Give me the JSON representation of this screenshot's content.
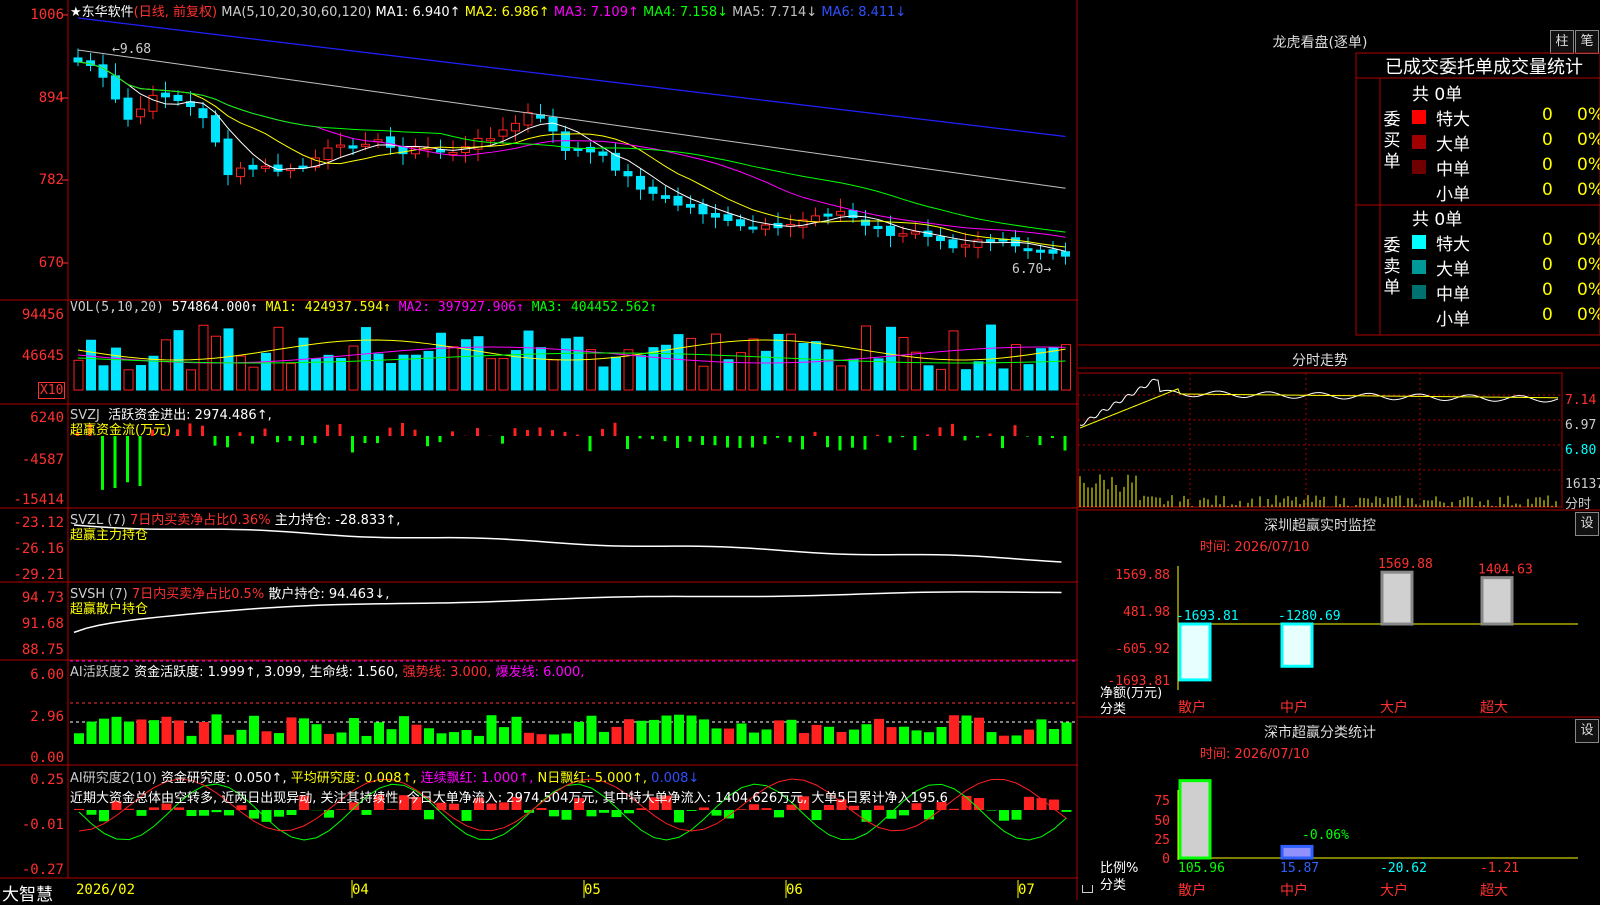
{
  "stock": {
    "star": "★",
    "name": "东华软件",
    "period": "(日线, 前复权)"
  },
  "ma_header": {
    "ma": "MA(5,10,20,30,60,120)",
    "ma1": "MA1: 6.940↑",
    "ma2": "MA2: 6.986↑",
    "ma3": "MA3: 7.109↑",
    "ma4": "MA4: 7.158↓",
    "ma5": "MA5: 7.714↓",
    "ma6": "MA6: 8.411↓"
  },
  "price_axis": [
    "1006",
    "894",
    "782",
    "670"
  ],
  "price_marks": {
    "high": "9.68",
    "low": "6.70"
  },
  "vol_header": {
    "name": "VOL(5,10,20)",
    "v": "574864.000↑",
    "ma1": "MA1: 424937.594↑",
    "ma2": "MA2: 397927.906↑",
    "ma3": "MA3: 404452.562↑"
  },
  "vol_axis": [
    "94456",
    "46645"
  ],
  "vol_unit": "X10",
  "svzj_header": {
    "name": "SVZJ",
    "label": "活跃资金进出: 2974.486↑,",
    "sub": "超赢资金流(万元)"
  },
  "svzj_axis": [
    "6240",
    "-4587",
    "-15414"
  ],
  "svzl_header": {
    "name": "SVZL (7)",
    "red": "7日内买卖净占比0.36%",
    "label": "主力持仓: -28.833↑,",
    "sub": "超赢主力持仓"
  },
  "svzl_axis": [
    "-23.12",
    "-26.16",
    "-29.21"
  ],
  "svsh_header": {
    "name": "SVSH (7)",
    "red": "7日内买卖净占比0.5%",
    "label": "散户持仓: 94.463↓,",
    "sub": "超赢散户持仓"
  },
  "svsh_axis": [
    "94.73",
    "91.68",
    "88.75"
  ],
  "ai_header": {
    "name": "AI活跃度2",
    "a": "资金活跃度: 1.999↑,",
    "b": "3.099,",
    "c": "生命线: 1.560,",
    "d": "强势线: 3.000,",
    "e": "爆发线: 6.000,"
  },
  "ai_axis": [
    "6.00",
    "2.96",
    "0.00"
  ],
  "ai2_header": {
    "name": "AI研究度2(10)",
    "a": "资金研究度: 0.050↑,",
    "b": "平均研究度: 0.008↑,",
    "c": "连续飘红: 1.000↑,",
    "d": "N日飘红: 5.000↑,",
    "e": "0.008↓"
  },
  "ai2_text": "近期大资金总体由空转多, 近两日出现异动, 关注其持续性, 今日大单净流入: 2974.504万元, 其中特大单净流入: 1404.626万元, 大单5日累计净入195.6",
  "ai2_axis": [
    "0.25",
    "-0.01",
    "-0.27"
  ],
  "date_axis": [
    "2026/02",
    "04",
    "05",
    "06",
    "07"
  ],
  "brand": "大智慧",
  "right": {
    "lhb": "龙虎看盘(逐单)",
    "btn_zhu": "柱",
    "btn_bi": "笔",
    "tabs": "已成交委托单成交量统计",
    "buy_label": "委买单",
    "sell_label": "委卖单",
    "buy_total": "共 0单",
    "sell_total": "共 0单",
    "buy_rows": [
      {
        "name": "特大",
        "n": "0",
        "p": "0%",
        "color": "#ff0000"
      },
      {
        "name": "大单",
        "n": "0",
        "p": "0%",
        "color": "#a00000"
      },
      {
        "name": "中单",
        "n": "0",
        "p": "0%",
        "color": "#700000"
      },
      {
        "name": "小单",
        "n": "0",
        "p": "0%",
        "color": "#000000"
      }
    ],
    "sell_rows": [
      {
        "name": "特大",
        "n": "0",
        "p": "0%",
        "color": "#00ffff"
      },
      {
        "name": "大单",
        "n": "0",
        "p": "0%",
        "color": "#009999"
      },
      {
        "name": "中单",
        "n": "0",
        "p": "0%",
        "color": "#007070"
      },
      {
        "name": "小单",
        "n": "0",
        "p": "0%",
        "color": "#000000"
      }
    ],
    "fs_title": "分时走势",
    "fs_axis": [
      "7.14",
      "6.97",
      "6.80"
    ],
    "fs_vol": "16137",
    "fs_unit": "分时",
    "mon_title": "深圳超赢实时监控",
    "mon_time": "时间: 2026/07/10",
    "mon_axis": [
      "1569.88",
      "481.98",
      "-605.92",
      "-1693.81"
    ],
    "mon_bars": [
      {
        "cat": "散户",
        "value": -1693.81,
        "label": "-1693.81",
        "lc": "#00ffff"
      },
      {
        "cat": "中户",
        "value": -1280.69,
        "label": "-1280.69",
        "lc": "#00ffff"
      },
      {
        "cat": "大户",
        "value": 1569.88,
        "label": "1569.88",
        "lc": "#ff3030"
      },
      {
        "cat": "超大",
        "value": 1404.63,
        "label": "1404.63",
        "lc": "#ff3030"
      }
    ],
    "mon_ylabel1": "净额(万元)",
    "mon_ylabel2": "分类",
    "set_btn": "设",
    "cls_title": "深市超赢分类统计",
    "cls_time": "时间: 2026/07/10",
    "cls_axis": [
      "75",
      "50",
      "25",
      "0"
    ],
    "cls_bars": [
      {
        "cat": "散户",
        "value": 105.96,
        "label": "105.96",
        "lc": "#00ff00"
      },
      {
        "cat": "中户",
        "value": 15.87,
        "label": "15.87",
        "lc": "#3060ff"
      },
      {
        "cat": "大户",
        "value": -20.62,
        "label": "-20.62",
        "lc": "#00ffff"
      },
      {
        "cat": "超大",
        "value": -1.21,
        "label": "-1.21",
        "lc": "#ff3030"
      }
    ],
    "cls_mid": "-0.06%",
    "cls_ylabel1": "比例%",
    "cls_ylabel2": "分类"
  },
  "colors": {
    "up": "#ff2020",
    "down": "#00e5ff",
    "grid": "#b00000",
    "ma1": "#ffffff",
    "ma2": "#ffff00",
    "ma3": "#ff00ff",
    "ma4": "#00ff00",
    "ma5": "#c0c0c0",
    "ma6": "#2020ff"
  },
  "chart_data": [
    {
      "type": "line",
      "title": "东华软件 (日线, 前复权)",
      "x": [
        "2026/02",
        "04",
        "05",
        "06",
        "07"
      ],
      "ylim": [
        670,
        1006
      ],
      "series": [
        {
          "name": "MA1",
          "values": [
            6.94
          ]
        },
        {
          "name": "MA2",
          "values": [
            6.986
          ]
        },
        {
          "name": "MA3",
          "values": [
            7.109
          ]
        },
        {
          "name": "MA4",
          "values": [
            7.158
          ]
        },
        {
          "name": "MA5",
          "values": [
            7.714
          ]
        },
        {
          "name": "MA6",
          "values": [
            8.411
          ]
        }
      ]
    },
    {
      "type": "bar",
      "title": "VOL(5,10,20)",
      "ylim": [
        0,
        94456
      ],
      "series": [
        {
          "name": "MA1",
          "values": [
            424937.594
          ]
        },
        {
          "name": "MA2",
          "values": [
            397927.906
          ]
        },
        {
          "name": "MA3",
          "values": [
            404452.562
          ]
        }
      ]
    },
    {
      "type": "bar",
      "title": "深圳超赢实时监控",
      "categories": [
        "散户",
        "中户",
        "大户",
        "超大"
      ],
      "values": [
        -1693.81,
        -1280.69,
        1569.88,
        1404.63
      ],
      "ylabel": "净额(万元)",
      "ylim": [
        -1693.81,
        1569.88
      ]
    },
    {
      "type": "bar",
      "title": "深市超赢分类统计",
      "categories": [
        "散户",
        "中户",
        "大户",
        "超大"
      ],
      "values": [
        105.96,
        15.87,
        -20.62,
        -1.21
      ],
      "ylabel": "比例%",
      "ylim": [
        0,
        75
      ]
    }
  ]
}
